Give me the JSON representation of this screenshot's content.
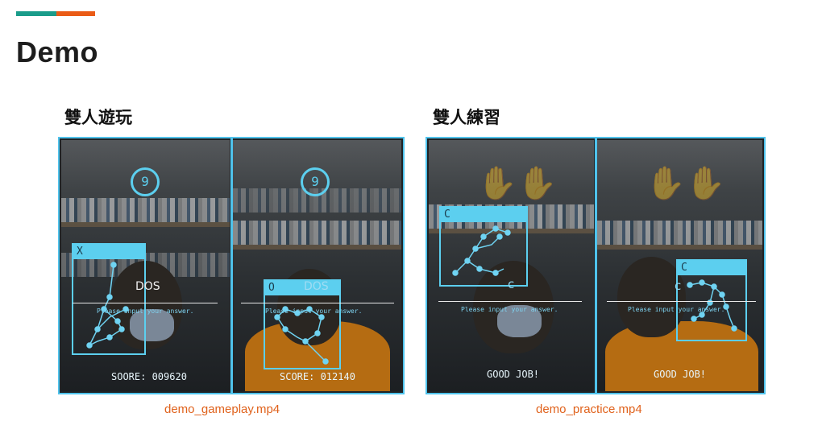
{
  "slide": {
    "title": "Demo"
  },
  "sections": [
    {
      "title": "雙人遊玩",
      "caption": "demo_gameplay.mp4"
    },
    {
      "title": "雙人練習",
      "caption": "demo_practice.mp4"
    }
  ],
  "gameplay": {
    "left": {
      "timer": "9",
      "box_letter": "X",
      "word": "DOS",
      "prompt": "Please input your answer.",
      "score": "SOORE: 009620"
    },
    "right": {
      "timer": "9",
      "box_letter": "O",
      "word": "DOS",
      "prompt": "Please input your answer.",
      "score": "SCORE: 012140"
    }
  },
  "practice": {
    "left": {
      "box_letter": "C",
      "letter": "c",
      "prompt": "Please input your answer.",
      "status": "GOOD JOB!"
    },
    "right": {
      "box_letter": "C",
      "letter": "c",
      "prompt": "Please input your answer.",
      "status": "GOOD JOB!"
    }
  },
  "colors": {
    "accent_teal": "#1a9c8a",
    "accent_orange": "#ea5b16",
    "overlay_cyan": "#5ccfef",
    "caption_orange": "#e0621c"
  }
}
